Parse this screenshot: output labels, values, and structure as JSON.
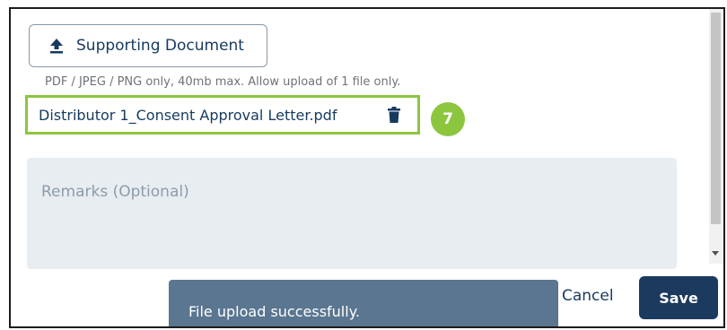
{
  "upload": {
    "button_label": "Supporting Document",
    "icon": "upload-icon",
    "hint": "PDF / JPEG / PNG only, 40mb max. Allow upload of 1 file only."
  },
  "file": {
    "name": "Distributor 1_Consent Approval Letter.pdf",
    "icon": "trash-icon"
  },
  "step_badge": "7",
  "remarks": {
    "placeholder": "Remarks (Optional)"
  },
  "actions": {
    "cancel_label": "Cancel",
    "save_label": "Save"
  },
  "toast": {
    "message": "File upload successfully."
  },
  "colors": {
    "accent_green": "#8cc63f",
    "primary_navy": "#1b3a5e",
    "toast_bg": "#5a7690",
    "remarks_bg": "#e8edf2"
  }
}
